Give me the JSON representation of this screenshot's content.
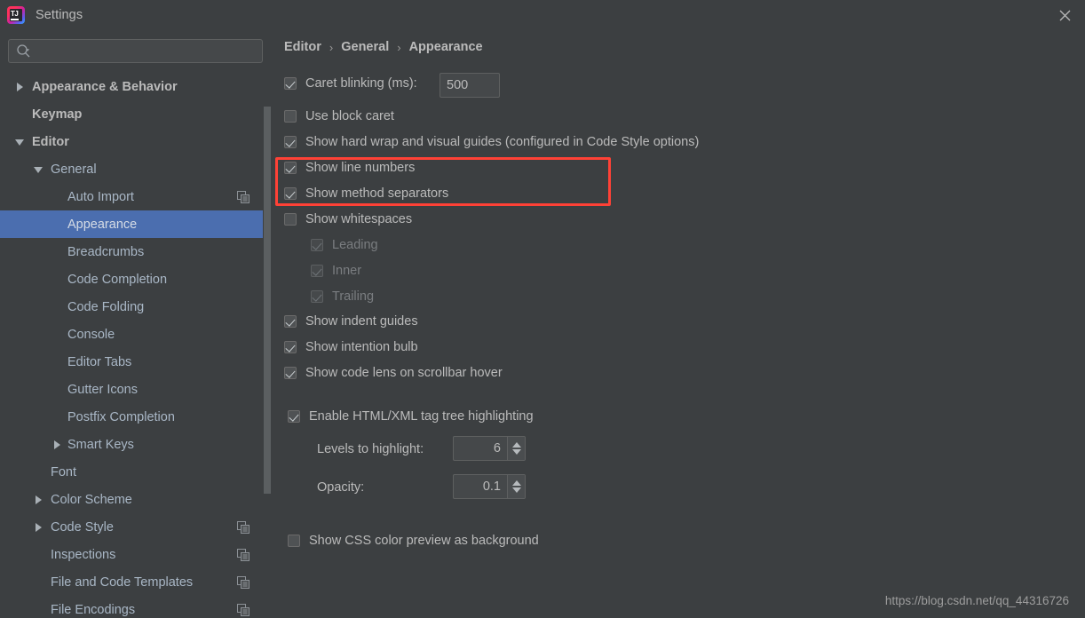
{
  "window": {
    "title": "Settings",
    "app_icon": "intellij-idea-icon",
    "close_icon": "close-icon"
  },
  "search": {
    "value": "",
    "placeholder": "",
    "icon": "search-icon"
  },
  "sidebar": {
    "items": [
      {
        "label": "Appearance & Behavior",
        "level": 0,
        "arrow": "collapsed",
        "bold": true,
        "selected": false,
        "copy_icon": false
      },
      {
        "label": "Keymap",
        "level": 0,
        "arrow": "none",
        "bold": true,
        "selected": false,
        "copy_icon": false
      },
      {
        "label": "Editor",
        "level": 0,
        "arrow": "expanded",
        "bold": true,
        "selected": false,
        "copy_icon": false
      },
      {
        "label": "General",
        "level": 1,
        "arrow": "expanded",
        "bold": false,
        "selected": false,
        "copy_icon": false
      },
      {
        "label": "Auto Import",
        "level": 2,
        "arrow": "none",
        "bold": false,
        "selected": false,
        "copy_icon": true
      },
      {
        "label": "Appearance",
        "level": 2,
        "arrow": "none",
        "bold": false,
        "selected": true,
        "copy_icon": false
      },
      {
        "label": "Breadcrumbs",
        "level": 2,
        "arrow": "none",
        "bold": false,
        "selected": false,
        "copy_icon": false
      },
      {
        "label": "Code Completion",
        "level": 2,
        "arrow": "none",
        "bold": false,
        "selected": false,
        "copy_icon": false
      },
      {
        "label": "Code Folding",
        "level": 2,
        "arrow": "none",
        "bold": false,
        "selected": false,
        "copy_icon": false
      },
      {
        "label": "Console",
        "level": 2,
        "arrow": "none",
        "bold": false,
        "selected": false,
        "copy_icon": false
      },
      {
        "label": "Editor Tabs",
        "level": 2,
        "arrow": "none",
        "bold": false,
        "selected": false,
        "copy_icon": false
      },
      {
        "label": "Gutter Icons",
        "level": 2,
        "arrow": "none",
        "bold": false,
        "selected": false,
        "copy_icon": false
      },
      {
        "label": "Postfix Completion",
        "level": 2,
        "arrow": "none",
        "bold": false,
        "selected": false,
        "copy_icon": false
      },
      {
        "label": "Smart Keys",
        "level": 2,
        "arrow": "collapsed",
        "bold": false,
        "selected": false,
        "copy_icon": false
      },
      {
        "label": "Font",
        "level": 1,
        "arrow": "none",
        "bold": false,
        "selected": false,
        "copy_icon": false
      },
      {
        "label": "Color Scheme",
        "level": 1,
        "arrow": "collapsed",
        "bold": false,
        "selected": false,
        "copy_icon": false
      },
      {
        "label": "Code Style",
        "level": 1,
        "arrow": "collapsed",
        "bold": false,
        "selected": false,
        "copy_icon": true
      },
      {
        "label": "Inspections",
        "level": 1,
        "arrow": "none",
        "bold": false,
        "selected": false,
        "copy_icon": true
      },
      {
        "label": "File and Code Templates",
        "level": 1,
        "arrow": "none",
        "bold": false,
        "selected": false,
        "copy_icon": true
      },
      {
        "label": "File Encodings",
        "level": 1,
        "arrow": "none",
        "bold": false,
        "selected": false,
        "copy_icon": true
      }
    ]
  },
  "breadcrumb": {
    "items": [
      "Editor",
      "General",
      "Appearance"
    ],
    "separator": "›"
  },
  "options": {
    "caret_blinking": {
      "label": "Caret blinking (ms):",
      "checked": true,
      "value": "500"
    },
    "use_block_caret": {
      "label": "Use block caret",
      "checked": false
    },
    "show_hard_wrap": {
      "label": "Show hard wrap and visual guides (configured in Code Style options)",
      "checked": true
    },
    "show_line_numbers": {
      "label": "Show line numbers",
      "checked": true
    },
    "show_method_separators": {
      "label": "Show method separators",
      "checked": true
    },
    "show_whitespaces": {
      "label": "Show whitespaces",
      "checked": false
    },
    "leading": {
      "label": "Leading",
      "checked": true,
      "disabled": true
    },
    "inner": {
      "label": "Inner",
      "checked": true,
      "disabled": true
    },
    "trailing": {
      "label": "Trailing",
      "checked": true,
      "disabled": true
    },
    "show_indent_guides": {
      "label": "Show indent guides",
      "checked": true
    },
    "show_intention_bulb": {
      "label": "Show intention bulb",
      "checked": true
    },
    "show_code_lens": {
      "label": "Show code lens on scrollbar hover",
      "checked": true
    },
    "enable_tag_tree": {
      "label": "Enable HTML/XML tag tree highlighting",
      "checked": true
    },
    "levels_to_highlight": {
      "label": "Levels to highlight:",
      "value": "6"
    },
    "opacity": {
      "label": "Opacity:",
      "value": "0.1"
    },
    "show_css_color_preview": {
      "label": "Show CSS color preview as background",
      "checked": false
    }
  },
  "annotation": {
    "highlight_color": "#ff4136"
  },
  "watermark": {
    "text": "https://blog.csdn.net/qq_44316726"
  },
  "colors": {
    "background": "#3c3f41",
    "selection": "#4b6eaf",
    "text": "#bbbbbb",
    "tree_text": "#a9b7c6",
    "field_background": "#45484a",
    "border": "#5e6060"
  }
}
